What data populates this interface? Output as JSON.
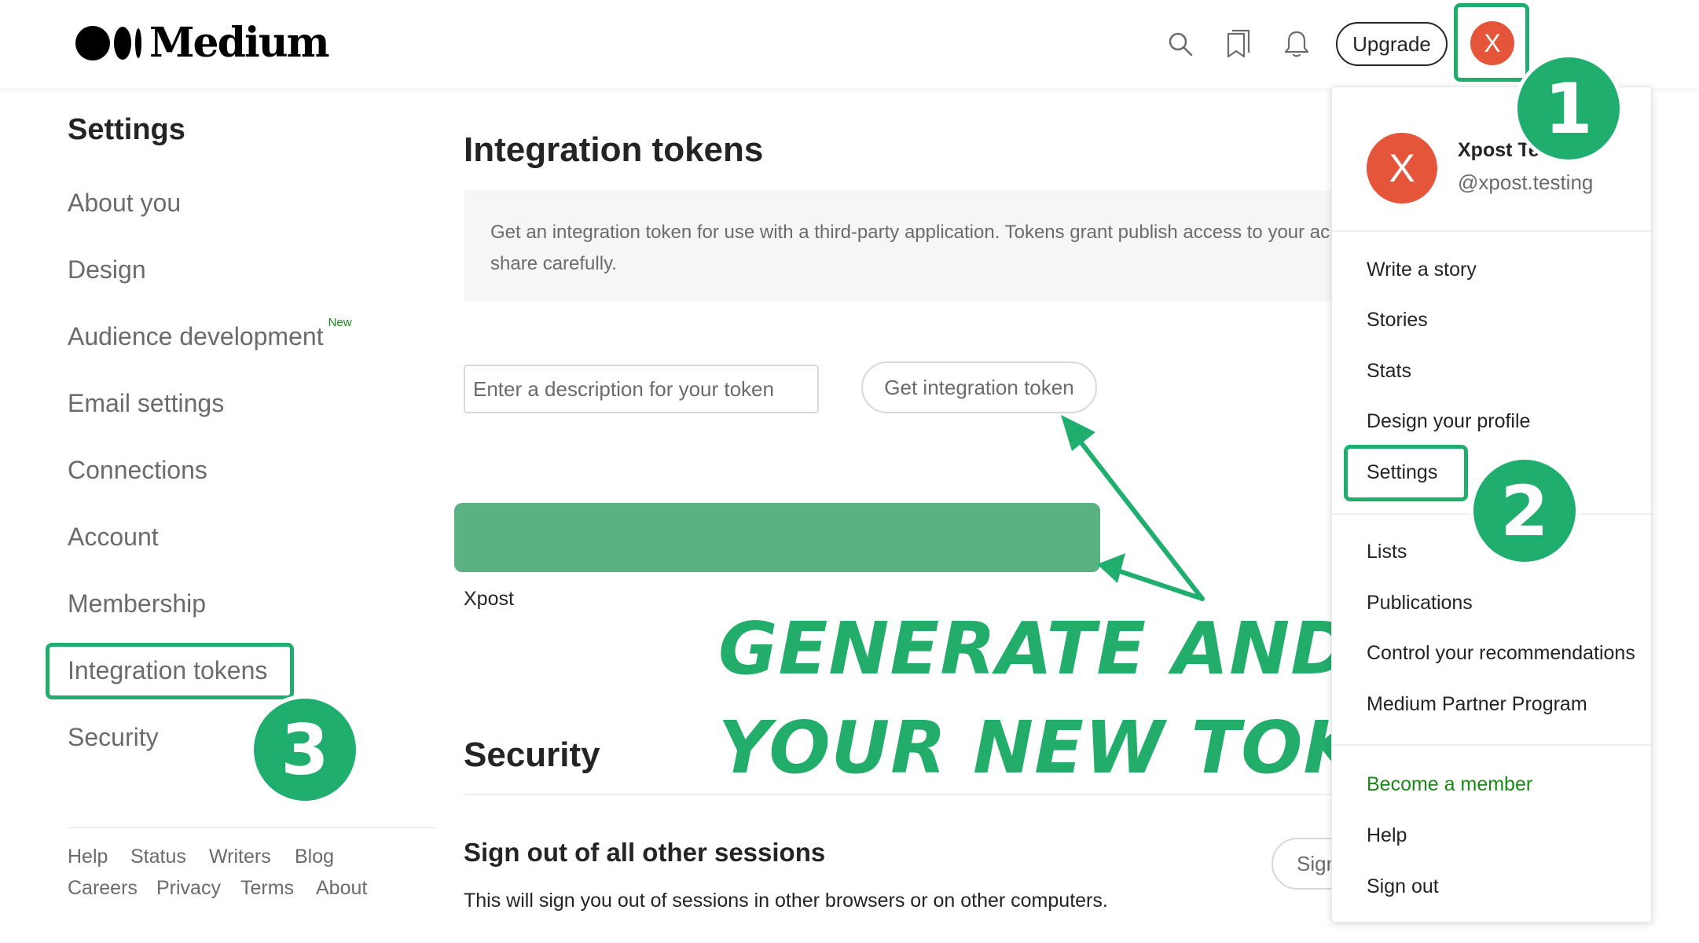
{
  "header": {
    "logo_text": "Medium",
    "upgrade_label": "Upgrade",
    "avatar_letter": "X"
  },
  "sidebar": {
    "title": "Settings",
    "items": [
      {
        "label": "About you"
      },
      {
        "label": "Design"
      },
      {
        "label": "Audience development",
        "badge": "New"
      },
      {
        "label": "Email settings"
      },
      {
        "label": "Connections"
      },
      {
        "label": "Account"
      },
      {
        "label": "Membership"
      },
      {
        "label": "Integration tokens"
      },
      {
        "label": "Security"
      }
    ],
    "footer": [
      "Help",
      "Status",
      "Writers",
      "Blog",
      "Careers",
      "Privacy",
      "Terms",
      "About"
    ]
  },
  "main": {
    "title": "Integration tokens",
    "info": "Get an integration token for use with a third-party application. Tokens grant publish access to your ac expire, so share carefully.",
    "input_placeholder": "Enter a description for your token",
    "get_token_label": "Get integration token",
    "token_name": "Xpost"
  },
  "annotation": {
    "line1": "GENERATE AND GET",
    "line2": "YOUR NEW TOKEN",
    "steps": [
      "1",
      "2",
      "3"
    ],
    "accent_color": "#1fae6e"
  },
  "security": {
    "title": "Security",
    "subtitle": "Sign out of all other sessions",
    "description": "This will sign you out of sessions in other browsers or on other computers.",
    "button_label": "Sign"
  },
  "dropdown": {
    "avatar_letter": "X",
    "name": "Xpost Tes",
    "handle": "@xpost.testing",
    "items": [
      {
        "label": "Write a story"
      },
      {
        "label": "Stories"
      },
      {
        "label": "Stats"
      },
      {
        "label": "Design your profile"
      },
      {
        "label": "Settings"
      },
      {
        "label": "Lists"
      },
      {
        "label": "Publications"
      },
      {
        "label": "Control your recommendations"
      },
      {
        "label": "Medium Partner Program"
      },
      {
        "label": "Become a member"
      },
      {
        "label": "Help"
      },
      {
        "label": "Sign out"
      }
    ]
  },
  "icons": [
    "search-icon",
    "bookmarks-icon",
    "bell-icon"
  ]
}
